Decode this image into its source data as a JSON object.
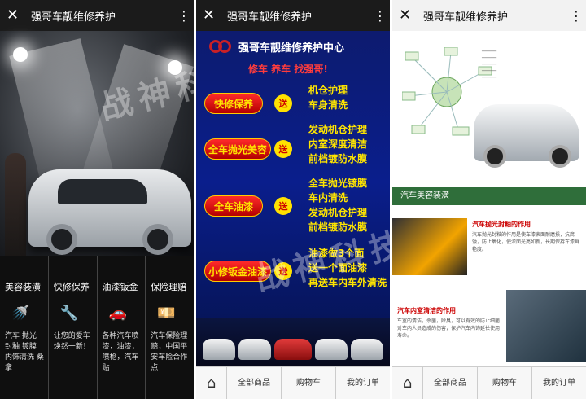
{
  "panels": [
    {
      "title": "强哥车靓维修养护",
      "services": [
        {
          "heading": "美容装潢",
          "desc": "汽车 抛光 封釉 镀膜 内饰清洗 桑拿"
        },
        {
          "heading": "快修保养",
          "desc": "让您的爱车焕然一新！"
        },
        {
          "heading": "油漆钣金",
          "desc": "各种汽车喷漆，油漆，喷枪，汽车贴"
        },
        {
          "heading": "保险理赔",
          "desc": "汽车保险理赔，中国平安车险合作点"
        }
      ]
    },
    {
      "title": "强哥车靓维修养护",
      "poster_title": "强哥车靓维修养护中心",
      "poster_slogan": "修车 养车 找强哥!",
      "promos": [
        {
          "pill": "快修保养",
          "badge": "送",
          "lines": [
            "机仓护理",
            "车身清洗"
          ]
        },
        {
          "pill": "全车抛光美容",
          "badge": "送",
          "lines": [
            "发动机仓护理",
            "内室深度清洁",
            "前档镀防水膜"
          ]
        },
        {
          "pill": "全车油漆",
          "badge": "送",
          "lines": [
            "全车抛光镀膜",
            "车内清洗",
            "发动机仓护理",
            "前档镀防水膜"
          ]
        },
        {
          "pill": "小修钣金油漆",
          "badge": "送",
          "lines": [
            "油漆做3个面",
            "送一个面油漆",
            "再送车内车外清洗"
          ]
        }
      ],
      "nav": [
        "全部商品",
        "购物车",
        "我的订单"
      ]
    },
    {
      "title": "强哥车靓维修养护",
      "section": "汽车美容装潢",
      "articles": [
        {
          "heading": "汽车抛光封釉的作用",
          "text": "汽车抛光封釉的作用是使车漆表面耐磨损，抗腐蚀，防止氧化，使漆面光亮如新，长期保持车漆鲜艳度。"
        },
        {
          "heading": "汽车内室清洁的作用",
          "text": "车室的清洁，杀菌，除臭，可以有效的防止细菌对车内人员造成的伤害，保护汽车内饰延长使用寿命。"
        }
      ],
      "nav": [
        "全部商品",
        "购物车",
        "我的订单"
      ]
    }
  ],
  "watermark": "战神科技"
}
